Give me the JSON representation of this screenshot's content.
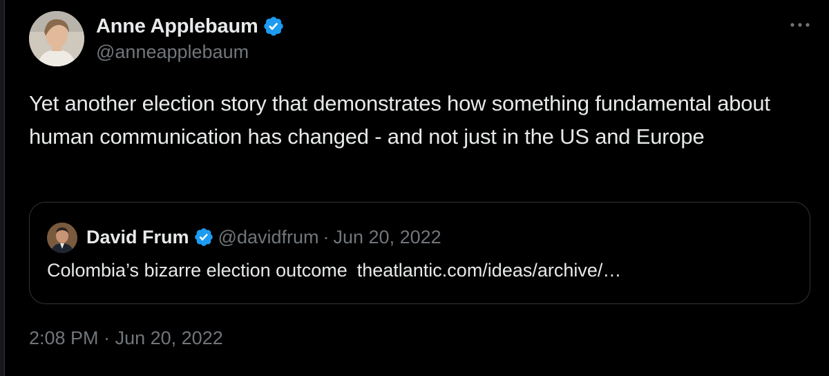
{
  "tweet": {
    "author": {
      "display_name": "Anne Applebaum",
      "handle": "@anneapplebaum",
      "verified_icon": "verified-badge-icon",
      "avatar_icon": "avatar-photo"
    },
    "more_icon": "more-options-icon",
    "text": "Yet another election story that demonstrates how something fundamental about human communication has changed - and not just in the US and Europe",
    "timestamp_time": "2:08 PM",
    "timestamp_sep": "·",
    "timestamp_date": "Jun 20, 2022"
  },
  "quote": {
    "display_name": "David Frum",
    "handle": "@davidfrum",
    "separator": "·",
    "date": "Jun 20, 2022",
    "text": "Colombia’s bizarre election outcome",
    "link": "theatlantic.com/ideas/archive/…"
  },
  "colors": {
    "background": "#000000",
    "text_primary": "#e7e9ea",
    "text_secondary": "#71767b",
    "verified_blue": "#1d9bf0",
    "border": "#2f3336"
  }
}
